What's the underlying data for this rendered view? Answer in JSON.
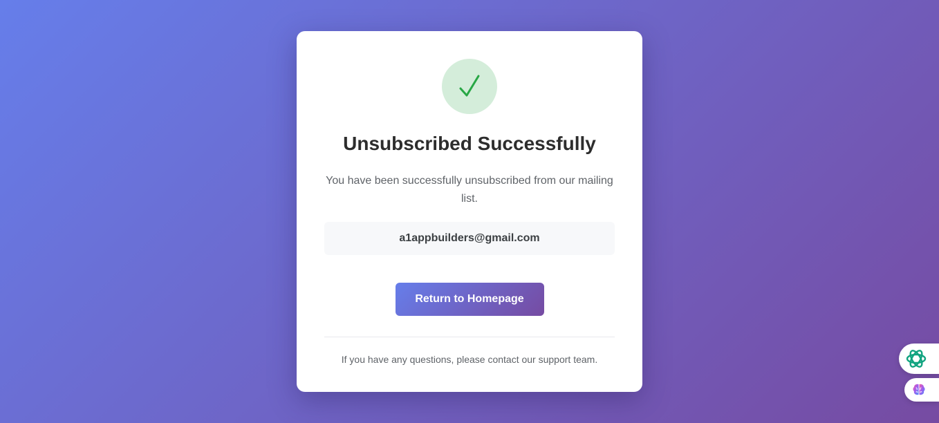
{
  "card": {
    "icon": "checkmark-icon",
    "title": "Unsubscribed Successfully",
    "message": "You have been successfully unsubscribed from our mailing list.",
    "email": "a1appbuilders@gmail.com",
    "return_button_label": "Return to Homepage",
    "footer_note": "If you have any questions, please contact our support team."
  },
  "side_widgets": {
    "assistant_icon": "chatgpt-icon",
    "brain_icon": "brain-icon"
  },
  "colors": {
    "background_gradient_start": "#667eea",
    "background_gradient_end": "#764ba2",
    "success_circle": "#d4edda",
    "success_check": "#28a745"
  }
}
